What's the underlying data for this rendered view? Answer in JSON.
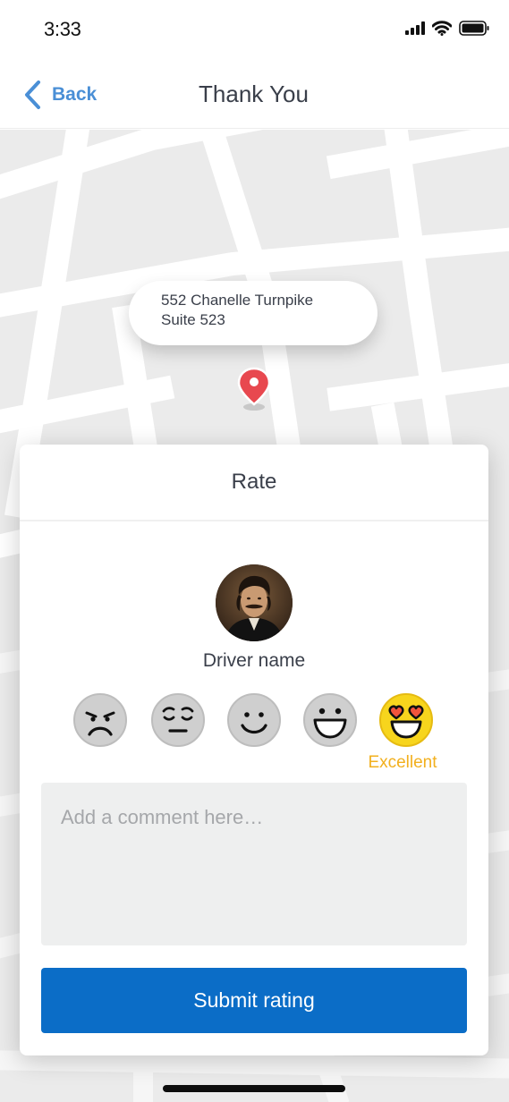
{
  "status_bar": {
    "time": "3:33"
  },
  "nav": {
    "back_label": "Back",
    "title": "Thank You"
  },
  "map": {
    "address_line1": "552 Chanelle Turnpike",
    "address_line2": "Suite 523",
    "pin_color": "#e8484f"
  },
  "rating_card": {
    "title": "Rate",
    "driver_name": "Driver name",
    "faces": [
      {
        "icon": "angry-face-icon",
        "selected": false
      },
      {
        "icon": "unamused-face-icon",
        "selected": false
      },
      {
        "icon": "smiling-face-icon",
        "selected": false
      },
      {
        "icon": "grinning-face-icon",
        "selected": false
      },
      {
        "icon": "heart-eyes-face-icon",
        "selected": true
      }
    ],
    "selected_label": "Excellent",
    "comment_placeholder": "Add a comment here…",
    "comment_value": "",
    "submit_label": "Submit rating"
  },
  "colors": {
    "accent": "#0b6dc7",
    "back_link": "#4a8fd6",
    "rating_highlight": "#f2b01e"
  }
}
